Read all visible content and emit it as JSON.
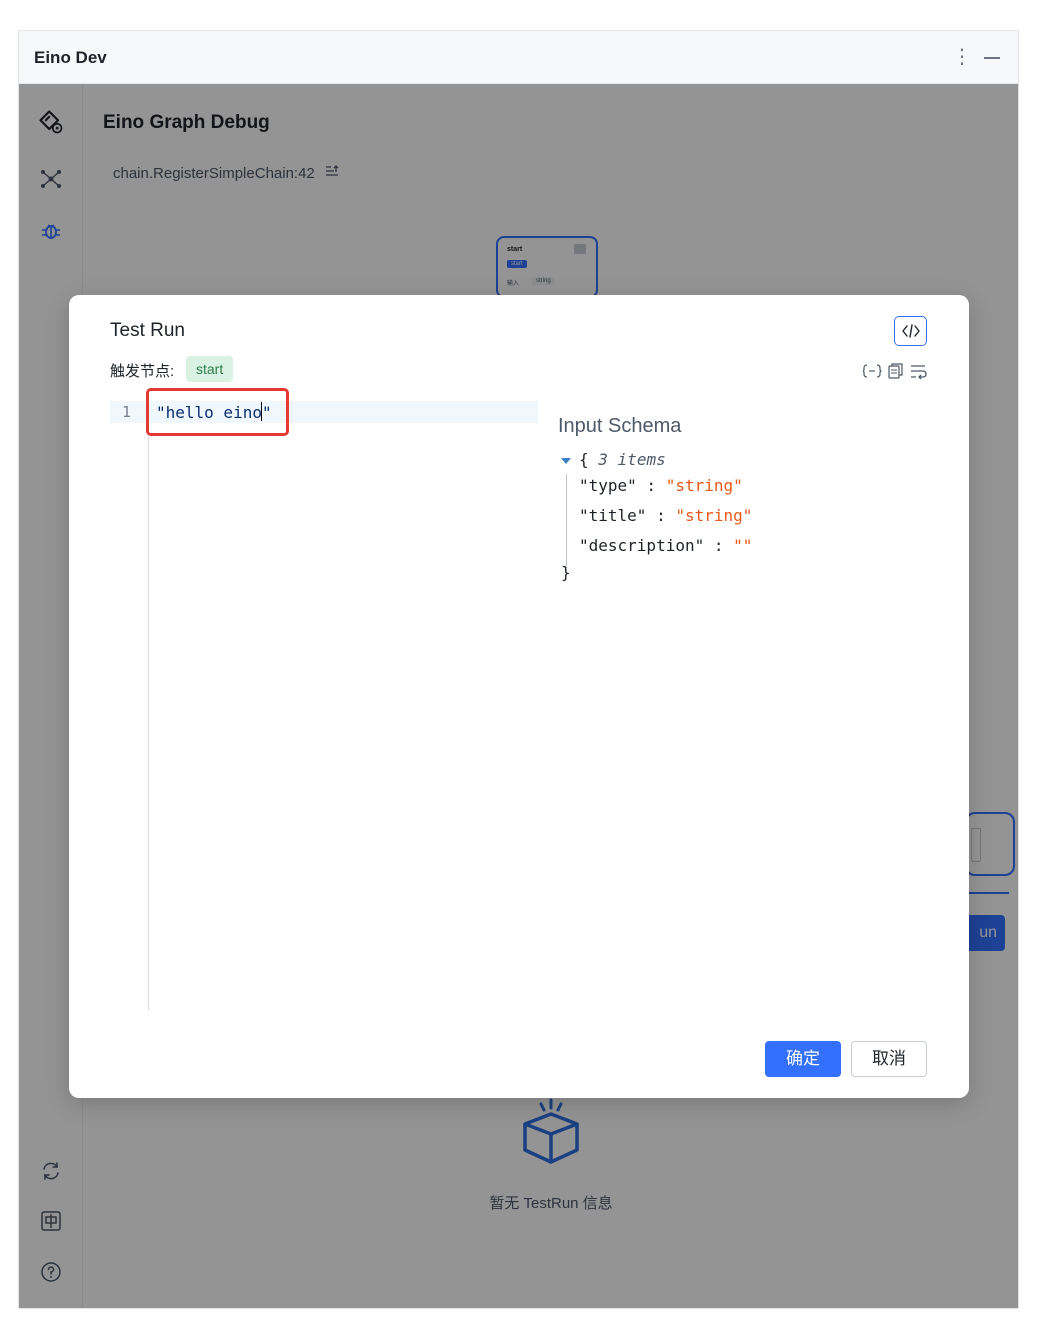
{
  "window": {
    "title": "Eino Dev",
    "menu_glyph": "⋮"
  },
  "sidebar": {
    "items": [
      {
        "icon": "eino-logo-icon"
      },
      {
        "icon": "graph-nodes-icon"
      },
      {
        "icon": "bug-icon",
        "active": true
      },
      {
        "icon": "refresh-icon"
      },
      {
        "icon": "chinese-language-icon"
      },
      {
        "icon": "help-icon"
      }
    ]
  },
  "page": {
    "title": "Eino Graph Debug",
    "chain_path": "chain.RegisterSimpleChain:42"
  },
  "node": {
    "title": "start",
    "tag": "start",
    "input_label": "输入",
    "input_type": "string"
  },
  "background_panel": {
    "run_label": "un"
  },
  "empty_state": {
    "text": "暂无 TestRun 信息"
  },
  "modal": {
    "title": "Test Run",
    "trigger_label": "触发节点:",
    "trigger_node": "start",
    "editor": {
      "line_number": "1",
      "code_before_cursor": "\"hello eino",
      "code_after_cursor": "\""
    },
    "schema": {
      "title": "Input Schema",
      "open_brace": "{",
      "count": "3 items",
      "close_brace": "}",
      "fields": [
        {
          "key": "\"type\"",
          "sep": " : ",
          "value": "\"string\""
        },
        {
          "key": "\"title\"",
          "sep": " : ",
          "value": "\"string\""
        },
        {
          "key": "\"description\"",
          "sep": " : ",
          "value": "\"\""
        }
      ]
    },
    "buttons": {
      "ok": "确定",
      "cancel": "取消"
    }
  },
  "colors": {
    "accent": "#3370ff",
    "tag_bg": "#d9f2e3",
    "string_value": "#e8591a",
    "highlight": "#e53935"
  }
}
